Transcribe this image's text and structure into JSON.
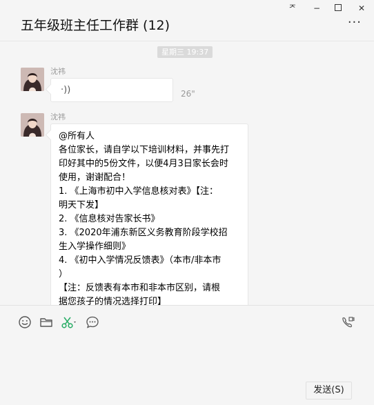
{
  "window": {
    "title": "五年级班主任工作群 (12)",
    "controls": {
      "pin": "ᅎ",
      "minimize": "−",
      "maximize": "□",
      "close": "✕"
    },
    "more": "···"
  },
  "chat": {
    "timestamp": "星期三 19:37",
    "messages": [
      {
        "sender": "沈祎",
        "type": "voice",
        "voice_glyph": "·))",
        "duration": "26\""
      },
      {
        "sender": "沈祎",
        "type": "text",
        "lines": [
          "@所有人",
          "各位家长，请自学以下培训材料，并事先打",
          "印好其中的5份文件，以便4月3日家长会时",
          "使用，谢谢配合！",
          "1. 《上海市初中入学信息核对表》【注：",
          "明天下发】",
          "2. 《信息核对告家长书》",
          "3. 《2020年浦东新区义务教育阶段学校招",
          "生入学操作细则》",
          "4. 《初中入学情况反馈表》（本市/非本市",
          "）",
          "【注：反馈表有本市和非本市区别，请根",
          "据您孩子的情况选择打印】"
        ]
      }
    ]
  },
  "toolbar": {
    "icons": [
      "emoji-icon",
      "folder-icon",
      "scissors-icon",
      "chat-history-icon",
      "video-call-icon"
    ],
    "send_label": "发送(S)"
  },
  "colors": {
    "background": "#f5f5f5",
    "bubble": "#ffffff",
    "scissors": "#2aae67",
    "timestamp_bg": "#dadada"
  }
}
